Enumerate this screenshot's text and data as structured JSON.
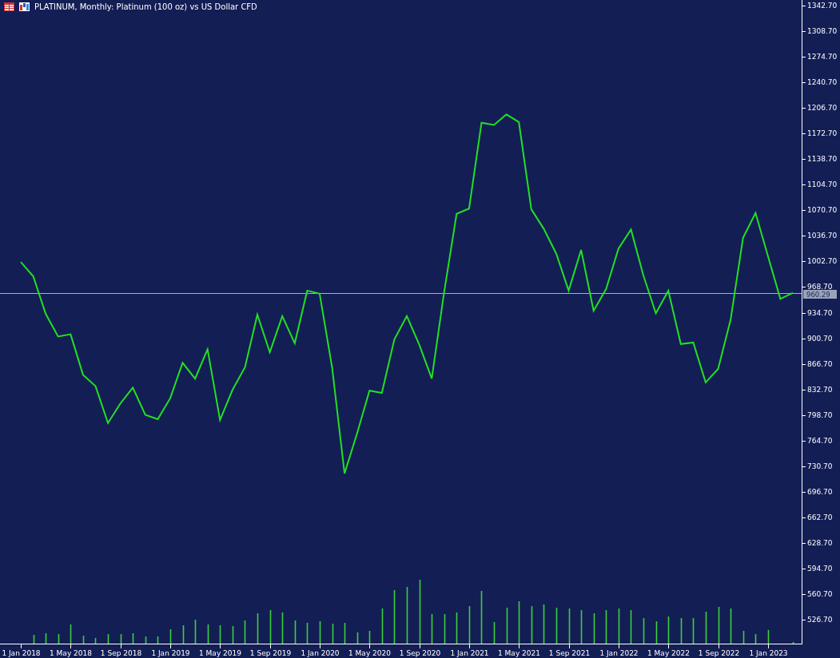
{
  "title": "PLATINUM, Monthly:  Platinum (100 oz) vs US Dollar CFD",
  "chart_data": {
    "type": "line",
    "categories": [
      "1 Jan 2018",
      null,
      null,
      null,
      "1 May 2018",
      null,
      null,
      null,
      "1 Sep 2018",
      null,
      null,
      null,
      "1 Jan 2019",
      null,
      null,
      null,
      "1 May 2019",
      null,
      null,
      null,
      "1 Sep 2019",
      null,
      null,
      null,
      "1 Jan 2020",
      null,
      null,
      null,
      "1 May 2020",
      null,
      null,
      null,
      "1 Sep 2020",
      null,
      null,
      null,
      "1 Jan 2021",
      null,
      null,
      null,
      "1 May 2021",
      null,
      null,
      null,
      "1 Sep 2021",
      null,
      null,
      null,
      "1 Jan 2022",
      null,
      null,
      null,
      "1 May 2022",
      null,
      null,
      null,
      "1 Sep 2022",
      null,
      null,
      null,
      "1 Jan 2023",
      null,
      null
    ],
    "series": [
      {
        "color": "#22e022",
        "values": [
          1002,
          983,
          933,
          903,
          906,
          852,
          837,
          788,
          814,
          835,
          799,
          793,
          821,
          868,
          847,
          886,
          792,
          832,
          862,
          932,
          882,
          930,
          894,
          964,
          960,
          862,
          721,
          774,
          831,
          828,
          899,
          930,
          892,
          847,
          962,
          1066,
          1073,
          1187,
          1184,
          1198,
          1188,
          1072,
          1046,
          1013,
          964,
          1018,
          937,
          966,
          1020,
          1045,
          984,
          934,
          964,
          893,
          895,
          842,
          860,
          925,
          1034,
          1067,
          1010,
          953,
          961
        ]
      }
    ],
    "ylim": [
      494.9,
      1350.1
    ],
    "ref_lines": [
      {
        "axis": "y",
        "value": 960.29,
        "label": "960.29"
      }
    ],
    "yticks": [
      {
        "value": 1342.7,
        "label": "1342.70"
      },
      {
        "value": 1308.7,
        "label": "1308.70"
      },
      {
        "value": 1274.7,
        "label": "1274.70"
      },
      {
        "value": 1240.7,
        "label": "1240.70"
      },
      {
        "value": 1206.7,
        "label": "1206.70"
      },
      {
        "value": 1172.7,
        "label": "1172.70"
      },
      {
        "value": 1138.7,
        "label": "1138.70"
      },
      {
        "value": 1104.7,
        "label": "1104.70"
      },
      {
        "value": 1070.7,
        "label": "1070.70"
      },
      {
        "value": 1036.7,
        "label": "1036.70"
      },
      {
        "value": 1002.7,
        "label": "1002.70"
      },
      {
        "value": 968.7,
        "label": "968.70"
      },
      {
        "value": 934.7,
        "label": "934.70"
      },
      {
        "value": 900.7,
        "label": "900.70"
      },
      {
        "value": 866.7,
        "label": "866.70"
      },
      {
        "value": 832.7,
        "label": "832.70"
      },
      {
        "value": 798.7,
        "label": "798.70"
      },
      {
        "value": 764.7,
        "label": "764.70"
      },
      {
        "value": 730.7,
        "label": "730.70"
      },
      {
        "value": 696.7,
        "label": "696.70"
      },
      {
        "value": 662.7,
        "label": "662.70"
      },
      {
        "value": 628.7,
        "label": "628.70"
      },
      {
        "value": 594.7,
        "label": "594.70"
      },
      {
        "value": 560.7,
        "label": "560.70"
      },
      {
        "value": 526.7,
        "label": "526.70"
      }
    ]
  }
}
